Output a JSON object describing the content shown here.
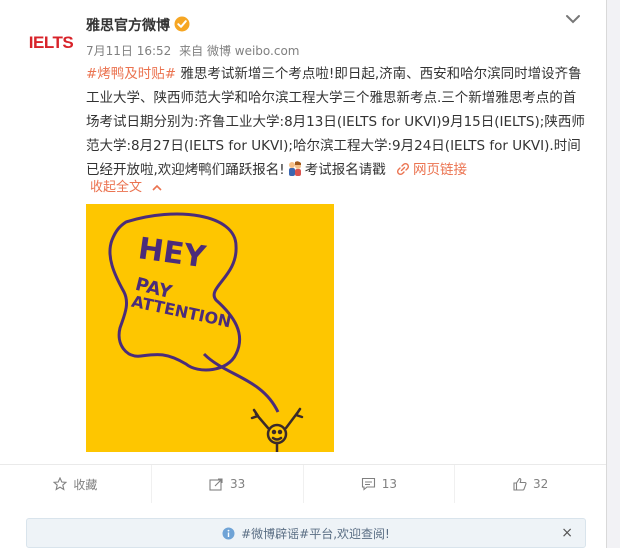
{
  "post": {
    "avatar_text": "IELTS",
    "username": "雅思官方微博",
    "date": "7月11日 16:52",
    "source": "来自 微博 weibo.com",
    "hashtag": "#烤鸭及时贴#",
    "text_main": " 雅思考试新增三个考点啦!即日起,济南、西安和哈尔滨同时增设齐鲁工业大学、陕西师范大学和哈尔滨工程大学三个雅思新考点.三个新增雅思考点的首场考试日期分别为:齐鲁工业大学:8月13日(IELTS for UKVI)9月15日(IELTS);陕西师范大学:8月27日(IELTS for UKVI);哈尔滨工程大学:9月24日(IELTS for UKVI).时间已经开放啦,欢迎烤鸭们踊跃报名!",
    "text_tail": "考试报名请戳",
    "link_label": "网页链接",
    "collapse_label": "收起全文",
    "image": {
      "line1": "HEY",
      "line2": "PAY",
      "line3": "ATTENTION",
      "background": "#fec600",
      "ink": "#4b2c7a"
    }
  },
  "actions": {
    "favorite": "收藏",
    "repost": "33",
    "comment": "13",
    "like": "32"
  },
  "notice": {
    "text": "#微博辟谣#平台,欢迎查阅!",
    "close": "×"
  },
  "colors": {
    "accent": "#eb7350",
    "verified": "#f6a623"
  }
}
